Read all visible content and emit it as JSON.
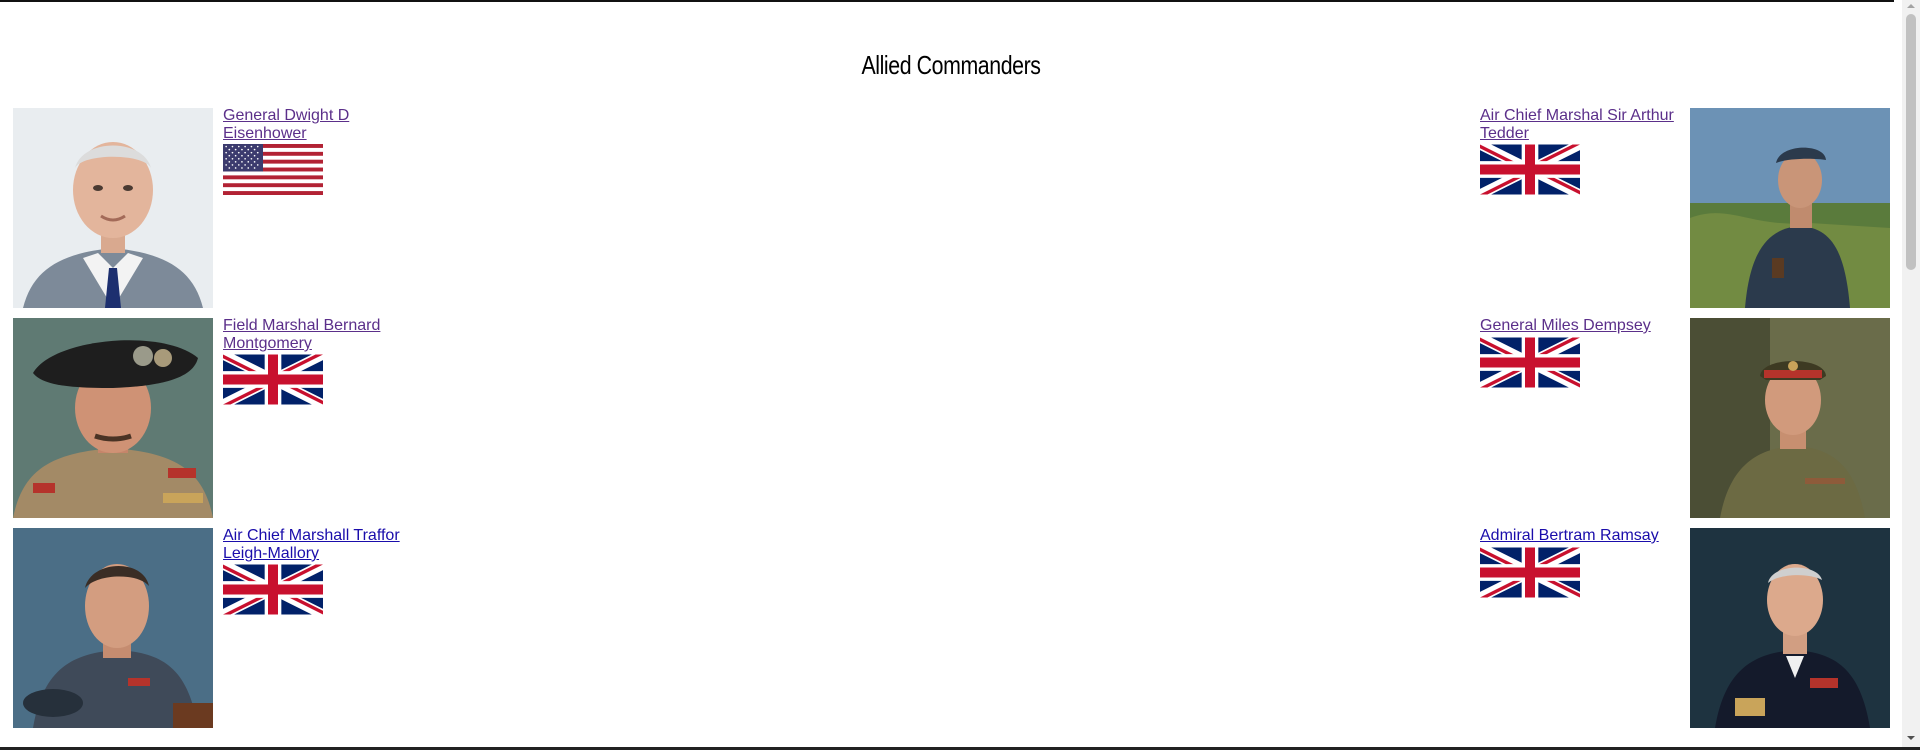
{
  "page": {
    "title": "Allied Commanders"
  },
  "commanders": [
    {
      "name": "General Dwight D Eisenhower",
      "flag": "usa-flag",
      "state": "visited",
      "side": "left"
    },
    {
      "name": "Field Marshal Bernard Montgomery",
      "flag": "uk-flag",
      "state": "visited",
      "side": "left"
    },
    {
      "name": "Air Chief Marshall Traffor Leigh-Mallory",
      "flag": "uk-flag",
      "state": "unvisited",
      "side": "left"
    },
    {
      "name": "Air Chief Marshal Sir Arthur Tedder",
      "flag": "uk-flag",
      "state": "visited",
      "side": "right"
    },
    {
      "name": "General Miles Dempsey",
      "flag": "uk-flag",
      "state": "visited",
      "side": "right"
    },
    {
      "name": "Admiral Bertram Ramsay",
      "flag": "uk-flag",
      "state": "unvisited",
      "side": "right"
    }
  ],
  "colors": {
    "link_visited": "#5b2f8a",
    "link_unvisited": "#1a0dab",
    "flag_red": "#c8102e",
    "flag_blue": "#012169",
    "usa_blue": "#3c3b6e",
    "usa_red": "#b22234"
  }
}
